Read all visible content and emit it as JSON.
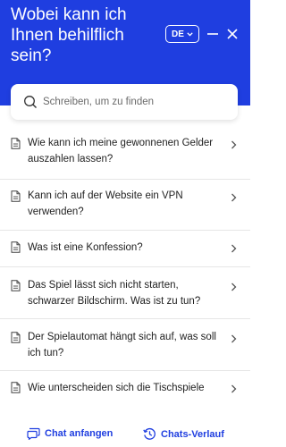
{
  "header": {
    "title": "Wobei kann ich Ihnen behilflich sein?",
    "language": "DE",
    "background_color": "#1f3ee0"
  },
  "search": {
    "placeholder": "Schreiben, um zu finden",
    "value": ""
  },
  "faq": {
    "items": [
      {
        "label": "Wie kann ich meine gewonnenen Gelder auszahlen lassen?"
      },
      {
        "label": "Kann ich auf der Website ein VPN verwenden?"
      },
      {
        "label": "Was ist eine Konfession?"
      },
      {
        "label": "Das Spiel lässt sich nicht starten, schwarzer Bildschirm. Was ist zu tun?"
      },
      {
        "label": "Der Spielautomat hängt sich auf, was soll ich tun?"
      },
      {
        "label": "Wie unterscheiden sich die Tischspiele"
      }
    ]
  },
  "footer": {
    "start_chat_label": "Chat anfangen",
    "history_label": "Chats-Verlauf",
    "accent_color": "#1f3ee0"
  }
}
